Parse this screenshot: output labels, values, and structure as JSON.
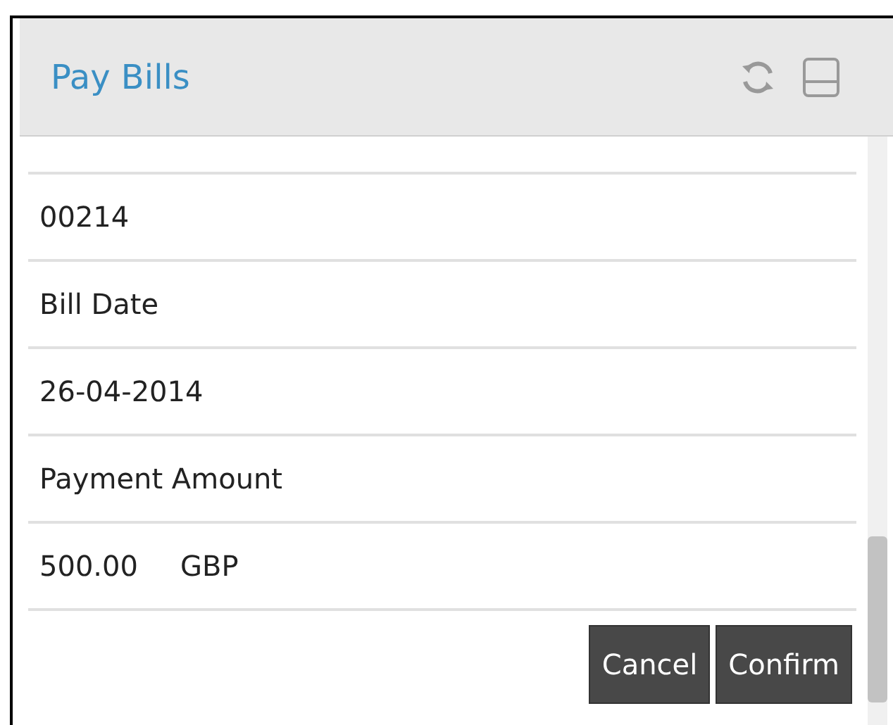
{
  "window": {
    "title": "Pay Bills"
  },
  "rows": [
    {
      "kind": "value",
      "text": "00214"
    },
    {
      "kind": "label",
      "text": "Bill Date"
    },
    {
      "kind": "value",
      "text": "26-04-2014"
    },
    {
      "kind": "label",
      "text": "Payment Amount"
    },
    {
      "kind": "amount",
      "text": "500.00",
      "currency": "GBP"
    }
  ],
  "buttons": [
    "Cancel",
    "Confirm"
  ]
}
